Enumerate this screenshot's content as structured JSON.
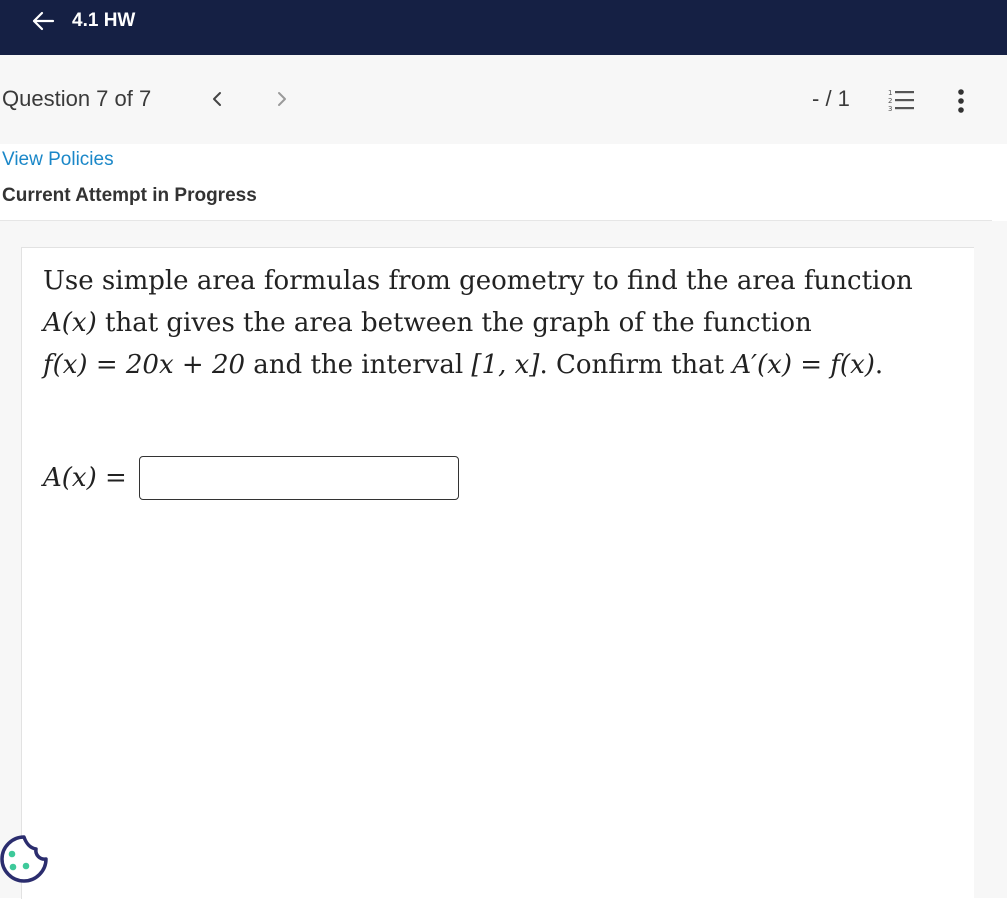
{
  "header": {
    "back_icon": "arrow-left-icon",
    "title": "4.1 HW"
  },
  "question_bar": {
    "label": "Question 7 of 7",
    "prev_icon": "chevron-left-icon",
    "next_icon": "chevron-right-icon",
    "score": "- / 1",
    "list_icon": "numbered-list-icon",
    "more_icon": "more-vertical-icon"
  },
  "info": {
    "policies_link": "View Policies",
    "attempt_status": "Current Attempt in Progress"
  },
  "question": {
    "line1": "Use simple area formulas from geometry to find the area function",
    "line2_math": "A(x)",
    "line2_text": " that gives the area between the graph of the function",
    "line3_math1": "f(x) = 20x + 20",
    "line3_text1": " and the interval ",
    "line3_math2": "[1, x]",
    "line3_text2": ".  Confirm that ",
    "line3_math3": "A′(x) = f(x)",
    "line3_text3": "."
  },
  "answer": {
    "label": "A(x) =",
    "value": "",
    "placeholder": ""
  },
  "cookie": {
    "icon": "cookie-icon"
  },
  "colors": {
    "header_bg": "#152044",
    "link": "#1a87c8",
    "cookie_outline": "#2b2d6e",
    "cookie_dots": "#3ec99a"
  }
}
